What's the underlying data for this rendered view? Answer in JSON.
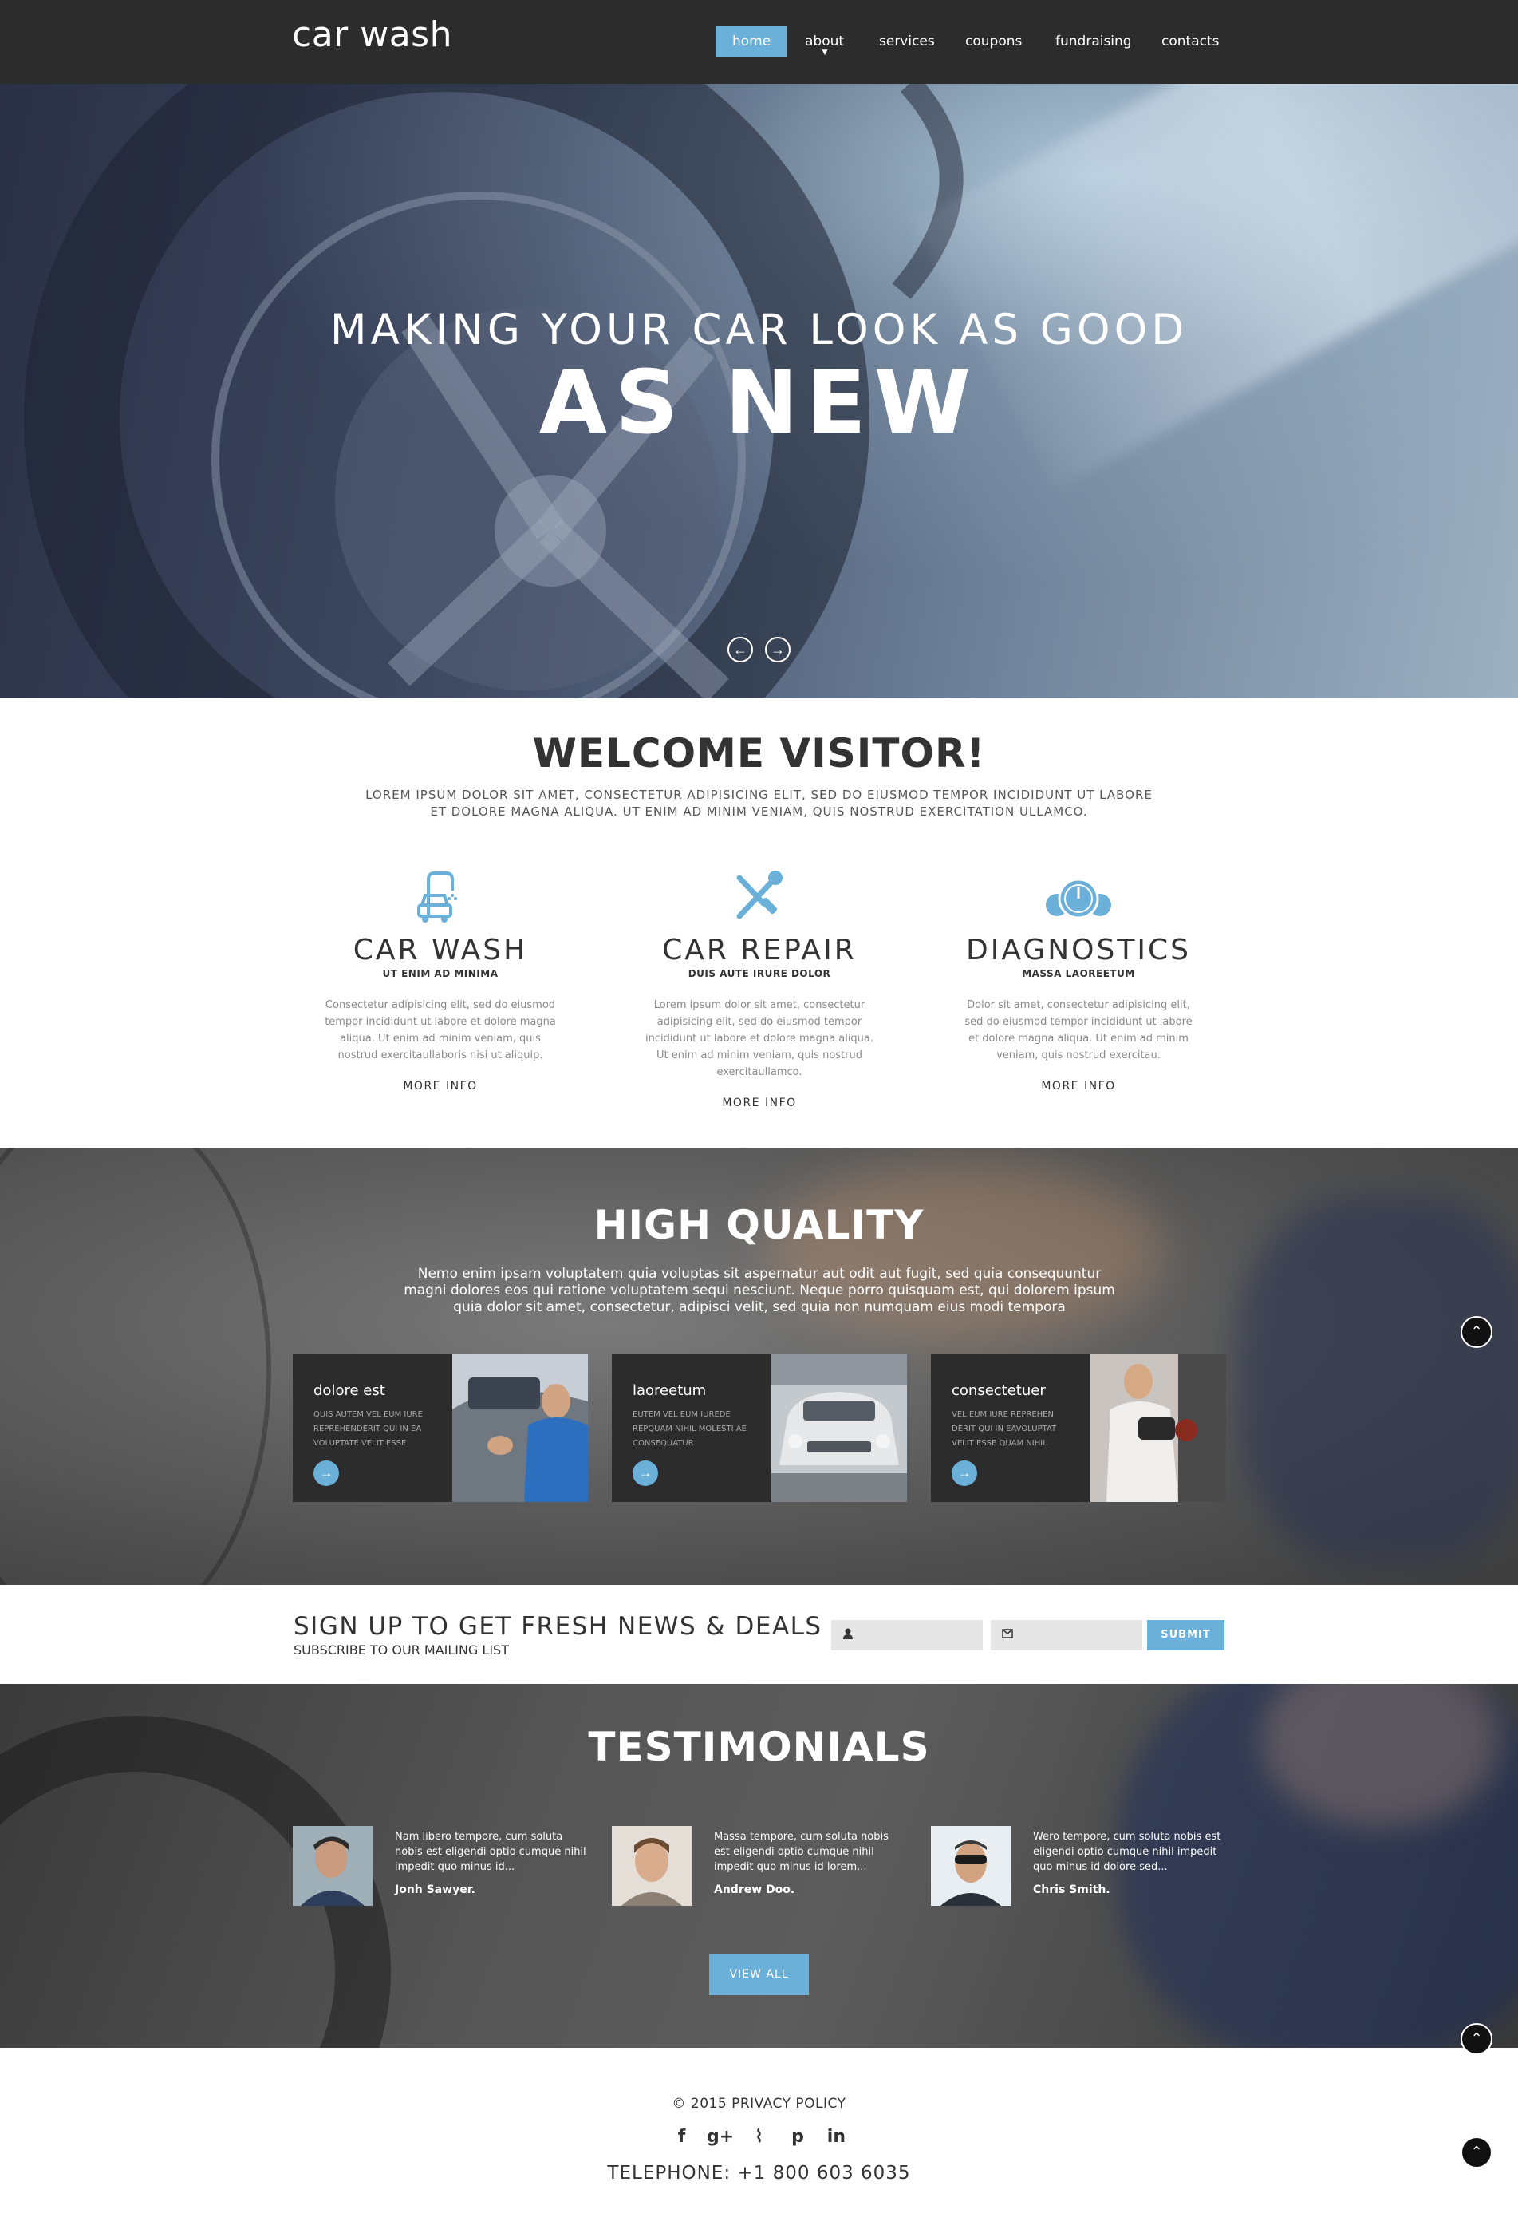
{
  "brand": {
    "logo": "car wash",
    "accent": "#6ab0d8",
    "dark": "#2c2c2c"
  },
  "nav": {
    "items": [
      {
        "label": "home",
        "active": true
      },
      {
        "label": "about",
        "has_dropdown": true
      },
      {
        "label": "services"
      },
      {
        "label": "coupons"
      },
      {
        "label": "fundraising"
      },
      {
        "label": "contacts"
      }
    ]
  },
  "hero": {
    "line1": "MAKING YOUR CAR LOOK AS GOOD",
    "line2": "AS NEW",
    "prev_icon": "arrow-left-icon",
    "next_icon": "arrow-right-icon",
    "prev_glyph": "←",
    "next_glyph": "→"
  },
  "welcome": {
    "title": "WELCOME VISITOR!",
    "text": "LOREM IPSUM DOLOR SIT AMET, CONSECTETUR ADIPISICING ELIT, SED DO EIUSMOD TEMPOR INCIDIDUNT UT LABORE ET DOLORE MAGNA ALIQUA. UT ENIM AD MINIM VENIAM, QUIS NOSTRUD EXERCITATION ULLAMCO."
  },
  "services": [
    {
      "icon": "car-wash-icon",
      "title": "CAR WASH",
      "subtitle": "UT ENIM AD MINIMA",
      "text": "Consectetur adipisicing elit, sed do eiusmod tempor incididunt ut labore et dolore magna aliqua. Ut enim ad minim veniam, quis nostrud exercitaullaboris nisi ut aliquip.",
      "link": "MORE INFO"
    },
    {
      "icon": "wrench-screwdriver-icon",
      "title": "CAR REPAIR",
      "subtitle": "DUIS AUTE IRURE DOLOR",
      "text": "Lorem ipsum dolor sit amet, consectetur adipisicing elit, sed do eiusmod tempor incididunt ut labore et dolore magna aliqua. Ut enim ad minim veniam, quis nostrud exercitaullamco.",
      "link": "MORE INFO"
    },
    {
      "icon": "gauges-icon",
      "title": "DIAGNOSTICS",
      "subtitle": "MASSA LAOREETUM",
      "text": "Dolor sit amet, consectetur adipisicing elit, sed do eiusmod tempor incididunt ut labore et dolore magna aliqua. Ut enim ad minim veniam, quis nostrud exercitau.",
      "link": "MORE INFO"
    }
  ],
  "quality": {
    "title": "HIGH QUALITY",
    "text": "Nemo enim ipsam voluptatem quia voluptas sit aspernatur aut odit aut fugit, sed quia consequuntur magni dolores eos qui ratione voluptatem sequi nesciunt. Neque porro quisquam est, qui dolorem ipsum quia dolor sit amet, consectetur, adipisci velit, sed quia non numquam eius modi tempora",
    "cards": [
      {
        "title": "dolore est",
        "text": "QUIS AUTEM VEL EUM IURE REPREHENDERIT QUI IN EA VOLUPTATE VELIT ESSE",
        "image": "washing-car-photo"
      },
      {
        "title": "laoreetum",
        "text": "EUTEM VEL EUM IUREDE REPQUAM NIHIL MOLESTI AE CONSEQUATUR",
        "image": "car-front-spray-photo"
      },
      {
        "title": "consectetuer",
        "text": "VEL EUM IURE REPREHEN DERIT QUI IN EAVOLUPTAT VELIT ESSE QUAM NIHIL",
        "image": "polishing-car-photo"
      }
    ],
    "card_button_glyph": "→"
  },
  "signup": {
    "title": "SIGN UP TO GET FRESH NEWS & DEALS",
    "subtitle": "SUBSCRIBE TO OUR MAILING LIST",
    "name_icon": "user-icon",
    "email_icon": "envelope-icon",
    "submit": "SUBMIT"
  },
  "testimonials": {
    "title": "TESTIMONIALS",
    "items": [
      {
        "text": "Nam libero tempore, cum soluta nobis est eligendi optio cumque nihil impedit quo minus id...",
        "name": "Jonh Sawyer."
      },
      {
        "text": "Massa tempore, cum soluta nobis est eligendi optio cumque nihil impedit quo minus id lorem...",
        "name": "Andrew Doo."
      },
      {
        "text": "Wero tempore, cum soluta nobis est eligendi optio cumque nihil impedit quo minus id dolore sed...",
        "name": "Chris Smith."
      }
    ],
    "button": "VIEW ALL"
  },
  "footer": {
    "copyright": "© 2015 PRIVACY POLICY",
    "socials": [
      {
        "name": "facebook-icon",
        "glyph": "f"
      },
      {
        "name": "google-plus-icon",
        "glyph": "g+"
      },
      {
        "name": "rss-icon",
        "glyph": "⌇"
      },
      {
        "name": "pinterest-icon",
        "glyph": "p"
      },
      {
        "name": "linkedin-icon",
        "glyph": "in"
      }
    ],
    "telephone": "TELEPHONE: +1 800 603 6035"
  },
  "scroll_top_icon": "chevron-up-icon",
  "scroll_top_glyph": "⌃"
}
